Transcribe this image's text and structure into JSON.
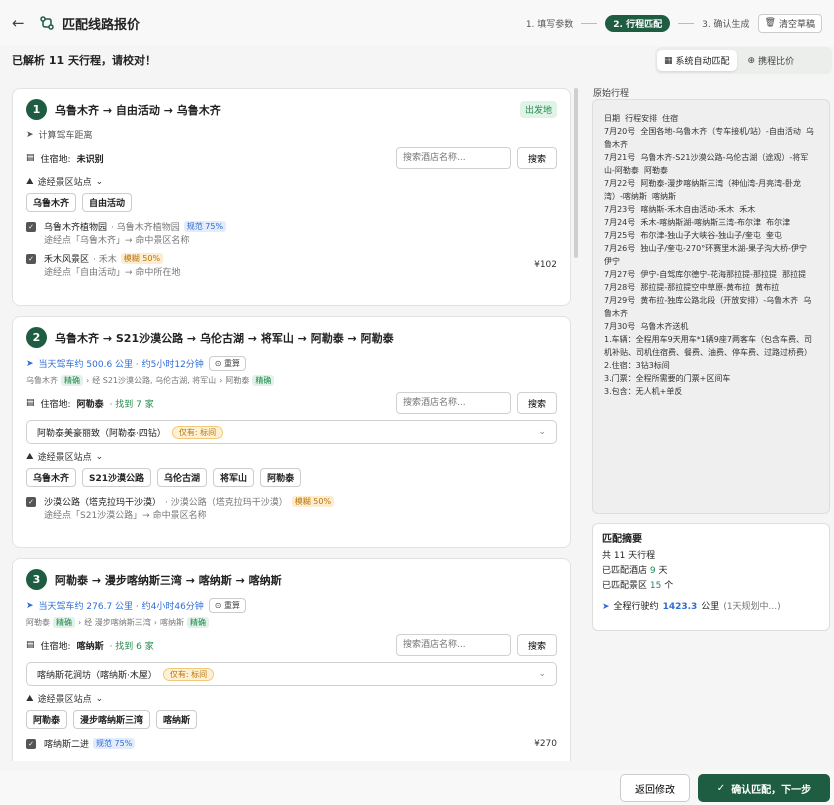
{
  "header": {
    "title": "匹配线路报价",
    "steps": [
      "1. 填写参数",
      "2. 行程匹配",
      "3. 确认生成"
    ],
    "clear_label": "清空草稿"
  },
  "parsed_text": "已解析 11 天行程，请校对！",
  "mode": {
    "options": [
      "系统自动匹配",
      "携程比价"
    ],
    "selected": "系统自动匹配"
  },
  "days": [
    {
      "num": "1",
      "route": "乌鲁木齐 → 自由活动 → 乌鲁木齐",
      "start_tag": "出发地",
      "calc_label": "计算驾车距离",
      "stay_label": "住宿地:",
      "stay_value": "未识别",
      "search_placeholder": "搜索酒店名称...",
      "search_btn": "搜索",
      "via_label": "途经景区站点",
      "chips": [
        "乌鲁木齐",
        "自由活动"
      ],
      "pois": [
        {
          "name": "乌鲁木齐植物园",
          "sub": "· 乌鲁木齐植物园",
          "badge": "规范 75%",
          "note": "途经点「乌鲁木齐」→ 命中景区名称",
          "price": ""
        },
        {
          "name": "禾木风景区",
          "sub": "· 禾木",
          "badge": "模糊 50%",
          "note": "途经点「自由活动」→ 命中所在地",
          "price": "¥102"
        }
      ]
    },
    {
      "num": "2",
      "route": "乌鲁木齐 → S21沙漠公路 → 乌伦古湖 → 将军山 → 阿勒泰 → 阿勒泰",
      "drive": "当天驾车约 500.6 公里 · 约5小时12分钟",
      "recalc": "重算",
      "via_from": "乌鲁木齐",
      "via_mid": "经 S21沙漠公路, 乌伦古湖, 将军山",
      "via_to": "阿勒泰",
      "precise": "精确",
      "stay_label": "住宿地:",
      "stay_value": "阿勒泰",
      "found": "· 找到 7 家",
      "search_placeholder": "搜索酒店名称...",
      "search_btn": "搜索",
      "hotel": "阿勒泰美豪丽致（阿勒泰·四钻）",
      "hotel_tag": "仅有: 标间",
      "via_label": "途经景区站点",
      "chips": [
        "乌鲁木齐",
        "S21沙漠公路",
        "乌伦古湖",
        "将军山",
        "阿勒泰"
      ],
      "pois": [
        {
          "name": "沙漠公路（塔克拉玛干沙漠）",
          "sub": "· 沙漠公路（塔克拉玛干沙漠）",
          "badge": "模糊 50%",
          "note": "途经点「S21沙漠公路」→ 命中景区名称",
          "price": ""
        }
      ]
    },
    {
      "num": "3",
      "route": "阿勒泰 → 漫步喀纳斯三湾 → 喀纳斯 → 喀纳斯",
      "drive": "当天驾车约 276.7 公里 · 约4小时46分钟",
      "recalc": "重算",
      "via_from": "阿勒泰",
      "via_mid": "经 漫步喀纳斯三湾",
      "via_to": "喀纳斯",
      "precise": "精确",
      "stay_label": "住宿地:",
      "stay_value": "喀纳斯",
      "found": "· 找到 6 家",
      "search_placeholder": "搜索酒店名称...",
      "search_btn": "搜索",
      "hotel": "喀纳斯花涧坊（喀纳斯·木屋）",
      "hotel_tag": "仅有: 标间",
      "via_label": "途经景区站点",
      "chips": [
        "阿勒泰",
        "漫步喀纳斯三湾",
        "喀纳斯"
      ],
      "pois": [
        {
          "name": "喀纳斯二进",
          "badge": "规范 75%",
          "price": "¥270"
        }
      ]
    }
  ],
  "raw": {
    "label": "原始行程",
    "text": "日期  行程安排  住宿\n7月20号  全国各地-乌鲁木齐（专车接机/站）-自由活动  乌鲁木齐\n7月21号  乌鲁木齐-S21沙漠公路-乌伦古湖（途观）-将军山-阿勒泰  阿勒泰\n7月22号  阿勒泰-漫步喀纳斯三湾（神仙湾-月亮湾-卧龙湾）-喀纳斯  喀纳斯\n7月23号  喀纳斯-禾木自由活动-禾木  禾木\n7月24号  禾木-喀纳斯湖-喀纳斯三湾-布尔津  布尔津\n7月25号  布尔津-独山子大峡谷-独山子/奎屯  奎屯\n7月26号  独山子/奎屯-270°环赛里木湖-果子沟大桥-伊宁  伊宁\n7月27号  伊宁-自驾库尔德宁-花海那拉提-那拉提  那拉提\n7月28号  那拉提-那拉提空中草原-黄布拉  黄布拉\n7月29号  黄布拉-独库公路北段（开放安排）-乌鲁木齐  乌鲁木齐\n7月30号  乌鲁木齐送机\n1.车辆：全程用车9天用车*1辆9座7两客车（包含车费、司机补贴、司机住宿费、餐费、油费、停车费、过路过桥费）\n2.住宿：3钻3标间\n3.门票：全程所需要的门票+区间车\n3.包含：无人机+单反"
  },
  "summary": {
    "title": "匹配摘要",
    "days_line": "共 11 天行程",
    "hotels_prefix": "已匹配酒店",
    "hotels_count": "9",
    "hotels_unit": "天",
    "poi_prefix": "已匹配景区",
    "poi_count": "15",
    "poi_unit": "个",
    "total_prefix": "全程行驶约",
    "total_km": "1423.3",
    "total_unit": "公里",
    "total_note": "(1天规划中...)"
  },
  "footer": {
    "back_label": "返回修改",
    "next_label": "确认匹配，下一步"
  }
}
